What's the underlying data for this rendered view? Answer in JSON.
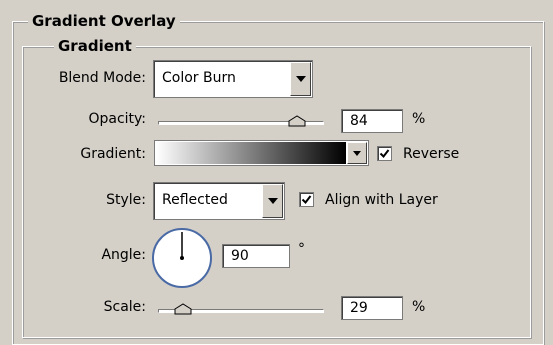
{
  "panel": {
    "title": "Gradient Overlay",
    "subtitle": "Gradient"
  },
  "fields": {
    "blend_mode": {
      "label": "Blend Mode:",
      "value": "Color Burn"
    },
    "opacity": {
      "label": "Opacity:",
      "value": "84",
      "unit": "%",
      "slider_fraction": 0.84
    },
    "gradient": {
      "label": "Gradient:",
      "colors": [
        "#ffffff",
        "#000000"
      ]
    },
    "reverse": {
      "label": "Reverse",
      "checked": true
    },
    "style": {
      "label": "Style:",
      "value": "Reflected"
    },
    "align_with_layer": {
      "label": "Align with Layer",
      "checked": true
    },
    "angle": {
      "label": "Angle:",
      "value": "90",
      "unit": "°"
    },
    "scale": {
      "label": "Scale:",
      "value": "29",
      "unit": "%",
      "slider_fraction": 0.15
    }
  },
  "icons": [
    "dropdown-arrow-icon",
    "slider-thumb-icon",
    "checkmark-icon",
    "angle-dial-icon"
  ]
}
